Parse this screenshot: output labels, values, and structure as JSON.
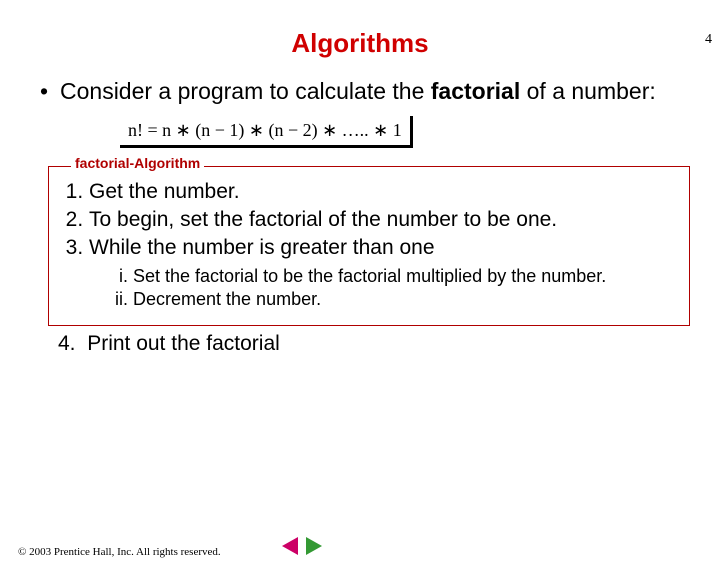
{
  "page_number": "4",
  "title": "Algorithms",
  "intro": {
    "bullet": "•",
    "text_before": "Consider a program to calculate the ",
    "bold_word": "factorial",
    "text_after": " of a number:"
  },
  "formula": "n! = n ∗ (n − 1) ∗ (n − 2) ∗ ….. ∗ 1",
  "algo_label": "factorial-Algorithm",
  "steps": {
    "s1": "Get the number.",
    "s2": "To begin, set the factorial of the number to be one.",
    "s3": "While the number is greater than one",
    "s3i": "Set the factorial to be the factorial multiplied by the number.",
    "s3ii": "Decrement the number.",
    "s4_num": "4.",
    "s4": "Print out the factorial"
  },
  "footer": "© 2003 Prentice Hall, Inc. All rights reserved."
}
